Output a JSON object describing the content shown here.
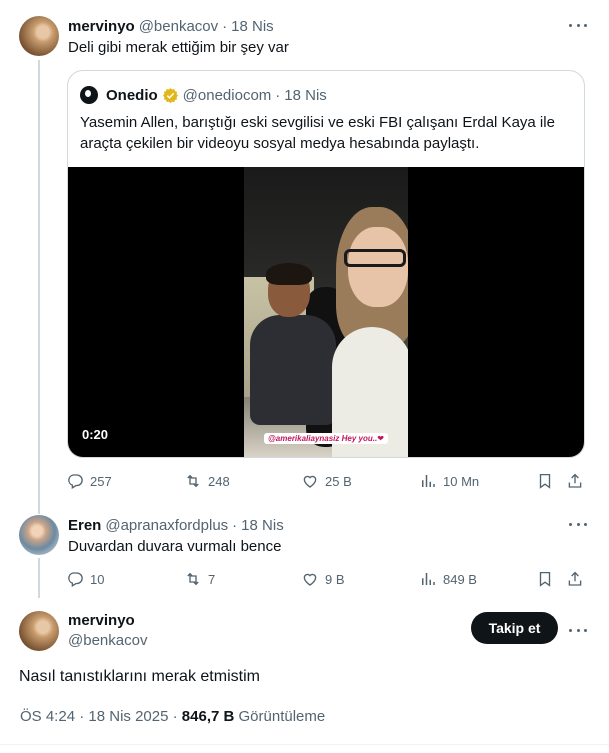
{
  "tweets": [
    {
      "name": "mervinyo",
      "handle": "@benkacov",
      "dot": "·",
      "time": "18 Nis",
      "text": "Deli gibi merak ettiğim bir şey var",
      "quote": {
        "name": "Onedio",
        "handle": "@onediocom",
        "dot": "·",
        "time": "18 Nis",
        "text": "Yasemin Allen, barıştığı eski sevgilisi ve eski FBI çalışanı Erdal Kaya ile araçta çekilen bir videoyu sosyal medya hesabında paylaştı.",
        "video_duration": "0:20",
        "video_tag": "@amerikaliaynasiz  Hey you..❤"
      },
      "actions": {
        "replies": "257",
        "reposts": "248",
        "likes": "25 B",
        "views": "10 Mn"
      }
    },
    {
      "name": "Eren",
      "handle": "@apranaxfordplus",
      "dot": "·",
      "time": "18 Nis",
      "text": "Duvardan duvara vurmalı bence",
      "actions": {
        "replies": "10",
        "reposts": "7",
        "likes": "9 B",
        "views": "849 B"
      }
    }
  ],
  "main": {
    "name": "mervinyo",
    "handle": "@benkacov",
    "follow_label": "Takip et",
    "text": "Nasıl tanıstıklarını merak etmistim",
    "time": "ÖS 4:24",
    "dot": "·",
    "date": "18 Nis 2025",
    "views_count": "846,7 B",
    "views_label": "Görüntüleme"
  },
  "icons": {
    "reply": "reply-icon",
    "repost": "repost-icon",
    "like": "heart-icon",
    "views": "views-icon",
    "bookmark": "bookmark-icon",
    "share": "share-icon",
    "more": "more-icon",
    "verified": "verified-badge-icon"
  },
  "colors": {
    "text": "#0f1419",
    "secondary": "#536471",
    "border": "#cfd9de",
    "verified": "#e2b719",
    "follow_bg": "#0f1419"
  }
}
